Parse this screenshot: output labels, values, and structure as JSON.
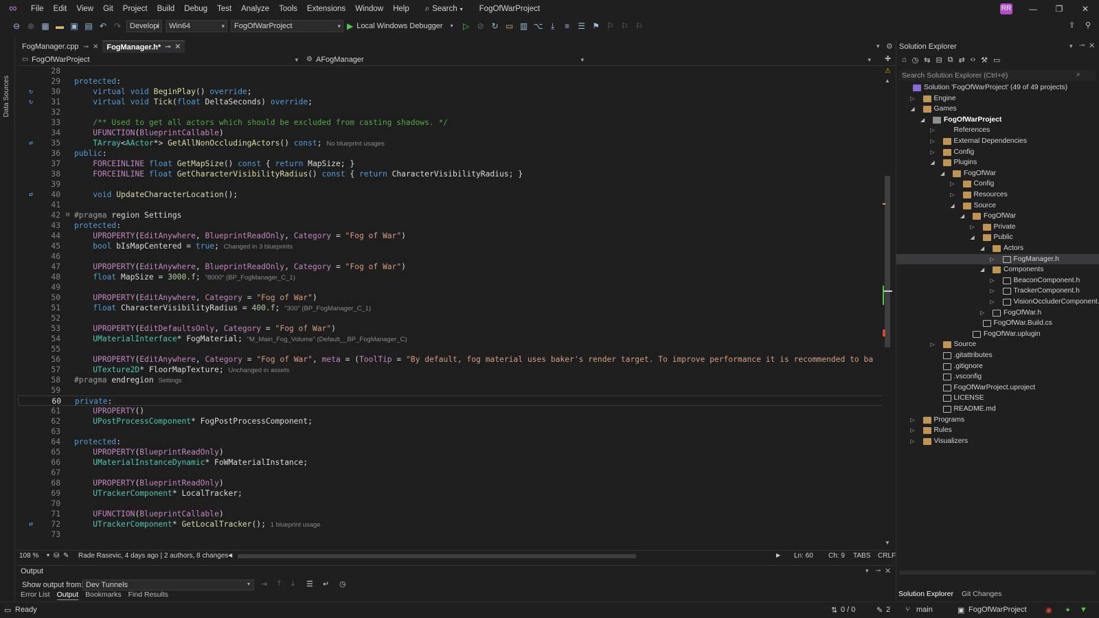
{
  "title": {
    "menu": [
      "File",
      "Edit",
      "View",
      "Git",
      "Project",
      "Build",
      "Debug",
      "Test",
      "Analyze",
      "Tools",
      "Extensions",
      "Window",
      "Help"
    ],
    "search": "Search",
    "project": "FogOfWarProject",
    "avatar": "RR"
  },
  "toolbar": {
    "config": "Developi",
    "platform": "Win64",
    "startup": "FogOfWarProject",
    "debugger": "Local Windows Debugger"
  },
  "rail": {
    "label": "Data Sources"
  },
  "tabs": [
    {
      "label": "FogManager.cpp"
    },
    {
      "label": "FogManager.h*"
    }
  ],
  "nav": {
    "project": "FogOfWarProject",
    "scope": "AFogManager"
  },
  "code": {
    "lines": [
      {
        "n": "28",
        "t": ""
      },
      {
        "n": "29",
        "t": "protected:"
      },
      {
        "n": "30",
        "t": "    virtual void BeginPlay() override;"
      },
      {
        "n": "31",
        "t": "    virtual void Tick(float DeltaSeconds) override;"
      },
      {
        "n": "32",
        "t": ""
      },
      {
        "n": "33",
        "t": "    /** Used to get all actors which should be excluded from casting shadows. */"
      },
      {
        "n": "34",
        "t": "    UFUNCTION(BlueprintCallable)"
      },
      {
        "n": "35",
        "t": "    TArray<AActor*> GetAllNonOccludingActors() const;",
        "h": "No blueprint usages"
      },
      {
        "n": "36",
        "t": "public:"
      },
      {
        "n": "37",
        "t": "    FORCEINLINE float GetMapSize() const { return MapSize; }"
      },
      {
        "n": "38",
        "t": "    FORCEINLINE float GetCharacterVisibilityRadius() const { return CharacterVisibilityRadius; }"
      },
      {
        "n": "39",
        "t": ""
      },
      {
        "n": "40",
        "t": "    void UpdateCharacterLocation();"
      },
      {
        "n": "41",
        "t": ""
      },
      {
        "n": "42",
        "t": "#pragma region Settings"
      },
      {
        "n": "43",
        "t": "protected:"
      },
      {
        "n": "44",
        "t": "    UPROPERTY(EditAnywhere, BlueprintReadOnly, Category = \"Fog of War\")"
      },
      {
        "n": "45",
        "t": "    bool bIsMapCentered = true;",
        "h": "Changed in 3 blueprints"
      },
      {
        "n": "46",
        "t": ""
      },
      {
        "n": "47",
        "t": "    UPROPERTY(EditAnywhere, BlueprintReadOnly, Category = \"Fog of War\")"
      },
      {
        "n": "48",
        "t": "    float MapSize = 3000.f;",
        "h": "\"8000\" (BP_FogManager_C_1)"
      },
      {
        "n": "49",
        "t": ""
      },
      {
        "n": "50",
        "t": "    UPROPERTY(EditAnywhere, Category = \"Fog of War\")"
      },
      {
        "n": "51",
        "t": "    float CharacterVisibilityRadius = 400.f;",
        "h": "\"300\" (BP_FogManager_C_1)"
      },
      {
        "n": "52",
        "t": ""
      },
      {
        "n": "53",
        "t": "    UPROPERTY(EditDefaultsOnly, Category = \"Fog of War\")"
      },
      {
        "n": "54",
        "t": "    UMaterialInterface* FogMaterial;",
        "h": "\"M_Main_Fog_Volume\" (Default__BP_FogManager_C)"
      },
      {
        "n": "55",
        "t": ""
      },
      {
        "n": "56",
        "t": "    UPROPERTY(EditAnywhere, Category = \"Fog of War\", meta = (ToolTip = \"By default, fog material uses baker's render target. To improve performance it is recommended to ba"
      },
      {
        "n": "57",
        "t": "    UTexture2D* FloorMapTexture;",
        "h": "Unchanged in assets"
      },
      {
        "n": "58",
        "t": "#pragma endregion",
        "h": "Settings"
      },
      {
        "n": "59",
        "t": ""
      },
      {
        "n": "60",
        "t": "private:"
      },
      {
        "n": "61",
        "t": "    UPROPERTY()"
      },
      {
        "n": "62",
        "t": "    UPostProcessComponent* FogPostProcessComponent;"
      },
      {
        "n": "63",
        "t": ""
      },
      {
        "n": "64",
        "t": "protected:"
      },
      {
        "n": "65",
        "t": "    UPROPERTY(BlueprintReadOnly)"
      },
      {
        "n": "66",
        "t": "    UMaterialInstanceDynamic* FoWMaterialInstance;"
      },
      {
        "n": "67",
        "t": ""
      },
      {
        "n": "68",
        "t": "    UPROPERTY(BlueprintReadOnly)"
      },
      {
        "n": "69",
        "t": "    UTrackerComponent* LocalTracker;"
      },
      {
        "n": "70",
        "t": ""
      },
      {
        "n": "71",
        "t": "    UFUNCTION(BlueprintCallable)"
      },
      {
        "n": "72",
        "t": "    UTrackerComponent* GetLocalTracker();",
        "h": "1 blueprint usage"
      },
      {
        "n": "73",
        "t": ""
      }
    ]
  },
  "editor_status": {
    "zoom": "108 %",
    "blame": "Rade Rasevic, 4 days ago | 2 authors, 8 changes",
    "ln": "Ln: 60",
    "ch": "Ch: 9",
    "tabs": "TABS",
    "eol": "CRLF"
  },
  "output": {
    "title": "Output",
    "from_label": "Show output from:",
    "from_value": "Dev Tunnels",
    "tabs": [
      "Error List",
      "Output",
      "Bookmarks",
      "Find Results"
    ]
  },
  "solution": {
    "title": "Solution Explorer",
    "search_placeholder": "Search Solution Explorer (Ctrl+é)",
    "tabs": [
      "Solution Explorer",
      "Git Changes"
    ],
    "tree": [
      {
        "l": "Solution 'FogOfWarProject' (49 of 49 projects)",
        "d": 0,
        "k": "sln"
      },
      {
        "l": "Engine",
        "d": 1,
        "k": "folder",
        "e": "c"
      },
      {
        "l": "Games",
        "d": 1,
        "k": "folder",
        "e": "o"
      },
      {
        "l": "FogOfWarProject",
        "d": 2,
        "k": "proj",
        "e": "o",
        "b": 1
      },
      {
        "l": "References",
        "d": 3,
        "k": "ref",
        "e": "c"
      },
      {
        "l": "External Dependencies",
        "d": 3,
        "k": "folder",
        "e": "c"
      },
      {
        "l": "Config",
        "d": 3,
        "k": "folder",
        "e": "c"
      },
      {
        "l": "Plugins",
        "d": 3,
        "k": "folder",
        "e": "o"
      },
      {
        "l": "FogOfWar",
        "d": 4,
        "k": "folder",
        "e": "o"
      },
      {
        "l": "Config",
        "d": 5,
        "k": "folder",
        "e": "c"
      },
      {
        "l": "Resources",
        "d": 5,
        "k": "folder",
        "e": "c"
      },
      {
        "l": "Source",
        "d": 5,
        "k": "folder",
        "e": "o"
      },
      {
        "l": "FogOfWar",
        "d": 6,
        "k": "folder",
        "e": "o"
      },
      {
        "l": "Private",
        "d": 7,
        "k": "folder",
        "e": "c"
      },
      {
        "l": "Public",
        "d": 7,
        "k": "folder",
        "e": "o"
      },
      {
        "l": "Actors",
        "d": 8,
        "k": "folder",
        "e": "o"
      },
      {
        "l": "FogManager.h",
        "d": 9,
        "k": "file",
        "e": "c",
        "s": 1
      },
      {
        "l": "Components",
        "d": 8,
        "k": "folder",
        "e": "o"
      },
      {
        "l": "BeaconComponent.h",
        "d": 9,
        "k": "file",
        "e": "c"
      },
      {
        "l": "TrackerComponent.h",
        "d": 9,
        "k": "file",
        "e": "c"
      },
      {
        "l": "VisionOccluderComponent.h",
        "d": 9,
        "k": "file",
        "e": "c"
      },
      {
        "l": "FogOfWar.h",
        "d": 8,
        "k": "file",
        "e": "c"
      },
      {
        "l": "FogOfWar.Build.cs",
        "d": 7,
        "k": "file"
      },
      {
        "l": "FogOfWar.uplugin",
        "d": 6,
        "k": "file"
      },
      {
        "l": "Source",
        "d": 3,
        "k": "folder",
        "e": "c"
      },
      {
        "l": ".gitattributes",
        "d": 3,
        "k": "file"
      },
      {
        "l": ".gitignore",
        "d": 3,
        "k": "file"
      },
      {
        "l": ".vsconfig",
        "d": 3,
        "k": "file"
      },
      {
        "l": "FogOfWarProject.uproject",
        "d": 3,
        "k": "file"
      },
      {
        "l": "LICENSE",
        "d": 3,
        "k": "file"
      },
      {
        "l": "README.md",
        "d": 3,
        "k": "file"
      },
      {
        "l": "Programs",
        "d": 1,
        "k": "folder",
        "e": "c"
      },
      {
        "l": "Rules",
        "d": 1,
        "k": "folder",
        "e": "c"
      },
      {
        "l": "Visualizers",
        "d": 1,
        "k": "folder",
        "e": "c"
      }
    ]
  },
  "status": {
    "ready": "Ready",
    "changes": "0 / 0",
    "edits": "2",
    "branch": "main",
    "repo": "FogOfWarProject"
  }
}
